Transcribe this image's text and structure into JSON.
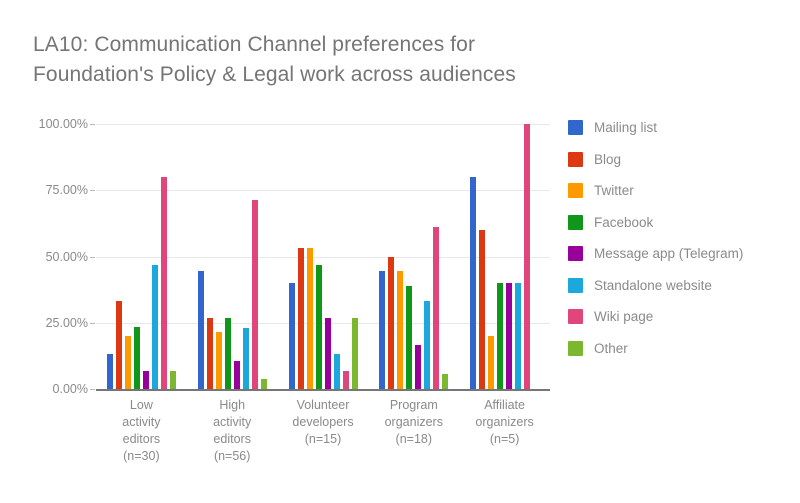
{
  "chart_data": {
    "type": "bar",
    "title": "LA10: Communication Channel preferences for Foundation's Policy & Legal work across audiences",
    "xlabel": "",
    "ylabel": "",
    "ylim": [
      0,
      100
    ],
    "grid": true,
    "legend_position": "right",
    "y_tick_labels": [
      "100.00%",
      "75.00%",
      "50.00%",
      "25.00%",
      "0.00%"
    ],
    "y_ticks": [
      100,
      75,
      50,
      25,
      0
    ],
    "categories": [
      "Low\nactivity\neditors\n(n=30)",
      "High\nactivity\neditors\n(n=56)",
      "Volunteer\ndevelopers\n(n=15)",
      "Program\norganizers\n(n=18)",
      "Affiliate\norganizers\n(n=5)"
    ],
    "series": [
      {
        "name": "Mailing list",
        "color": "#3366cc",
        "values": [
          13.3,
          44.6,
          40.0,
          44.4,
          80.0
        ]
      },
      {
        "name": "Blog",
        "color": "#dc3912",
        "values": [
          33.3,
          26.8,
          53.3,
          50.0,
          60.0
        ]
      },
      {
        "name": "Twitter",
        "color": "#ff9900",
        "values": [
          20.0,
          21.4,
          53.3,
          44.4,
          20.0
        ]
      },
      {
        "name": "Facebook",
        "color": "#109618",
        "values": [
          23.3,
          26.8,
          46.7,
          38.9,
          40.0
        ]
      },
      {
        "name": "Message app (Telegram)",
        "color": "#990099",
        "values": [
          6.7,
          10.7,
          26.7,
          16.7,
          40.0
        ]
      },
      {
        "name": "Standalone website",
        "color": "#1ca8dd",
        "values": [
          46.7,
          23.2,
          13.3,
          33.3,
          40.0
        ]
      },
      {
        "name": "Wiki page",
        "color": "#e0457b",
        "values": [
          80.0,
          71.4,
          6.7,
          61.1,
          100.0
        ]
      },
      {
        "name": "Other",
        "color": "#7cb82f",
        "values": [
          6.7,
          3.6,
          26.7,
          5.6,
          0.0
        ]
      }
    ]
  }
}
